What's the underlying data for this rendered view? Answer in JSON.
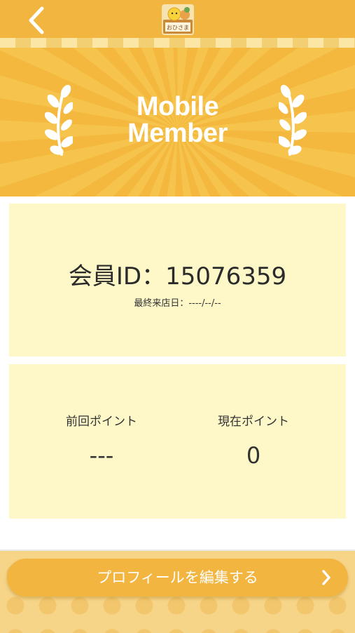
{
  "header": {
    "back_icon": "chevron-left-icon",
    "logo_text": "おひさま",
    "accent_color": "#f1b540"
  },
  "hero": {
    "title_line1": "Mobile",
    "title_line2": "Member"
  },
  "member": {
    "id_text": "会員ID：15076359",
    "last_visit": "最終来店日：----/--/--"
  },
  "points": {
    "previous_label": "前回ポイント",
    "previous_value": "---",
    "current_label": "現在ポイント",
    "current_value": "0"
  },
  "footer": {
    "edit_profile_label": "プロフィールを編集する",
    "edit_icon": "chevron-right-icon"
  }
}
